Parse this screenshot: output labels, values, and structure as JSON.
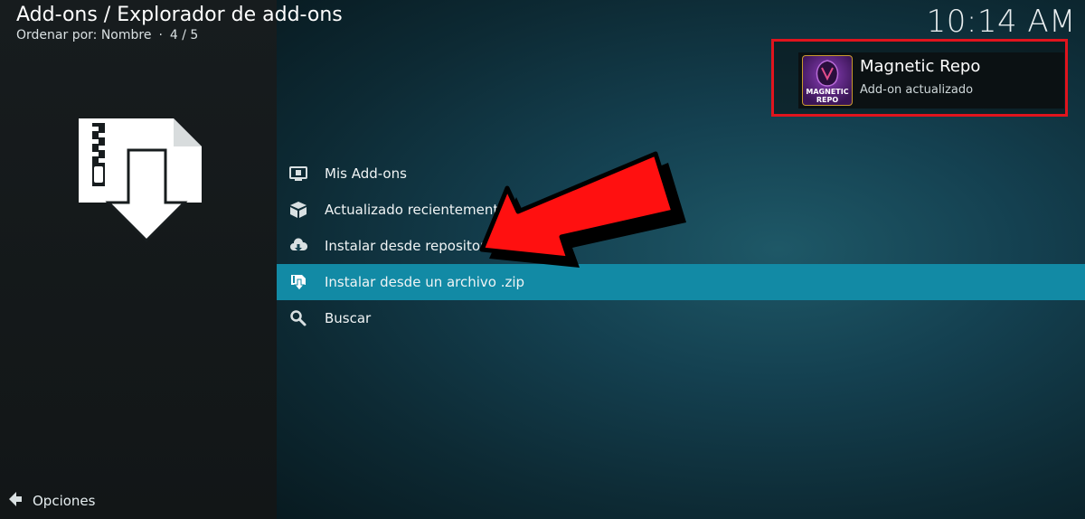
{
  "header": {
    "breadcrumb": "Add-ons / Explorador de add-ons",
    "sort_label": "Ordenar por: Nombre",
    "position": "4 / 5",
    "separator": "·"
  },
  "clock": "10:14 AM",
  "left_panel": {
    "icon": "zip-install-icon",
    "options_label": "Opciones",
    "options_icon": "options-arrow-icon"
  },
  "menu": {
    "items": [
      {
        "label": "Mis Add-ons",
        "icon": "monitor-icon",
        "selected": false
      },
      {
        "label": "Actualizado recientemente",
        "icon": "box-icon",
        "selected": false
      },
      {
        "label": "Instalar desde repositorio",
        "icon": "cloud-download-icon",
        "selected": false
      },
      {
        "label": "Instalar desde un archivo .zip",
        "icon": "zip-file-icon",
        "selected": true
      },
      {
        "label": "Buscar",
        "icon": "search-icon",
        "selected": false
      }
    ]
  },
  "notification": {
    "title": "Magnetic Repo",
    "subtitle": "Add-on actualizado",
    "thumbnail_text_line1": "MAGNETIC",
    "thumbnail_text_line2": "REPO",
    "highlight_color": "#e0141d"
  },
  "colors": {
    "selection": "#128aa5",
    "annotation_arrow": "#ff1010"
  }
}
